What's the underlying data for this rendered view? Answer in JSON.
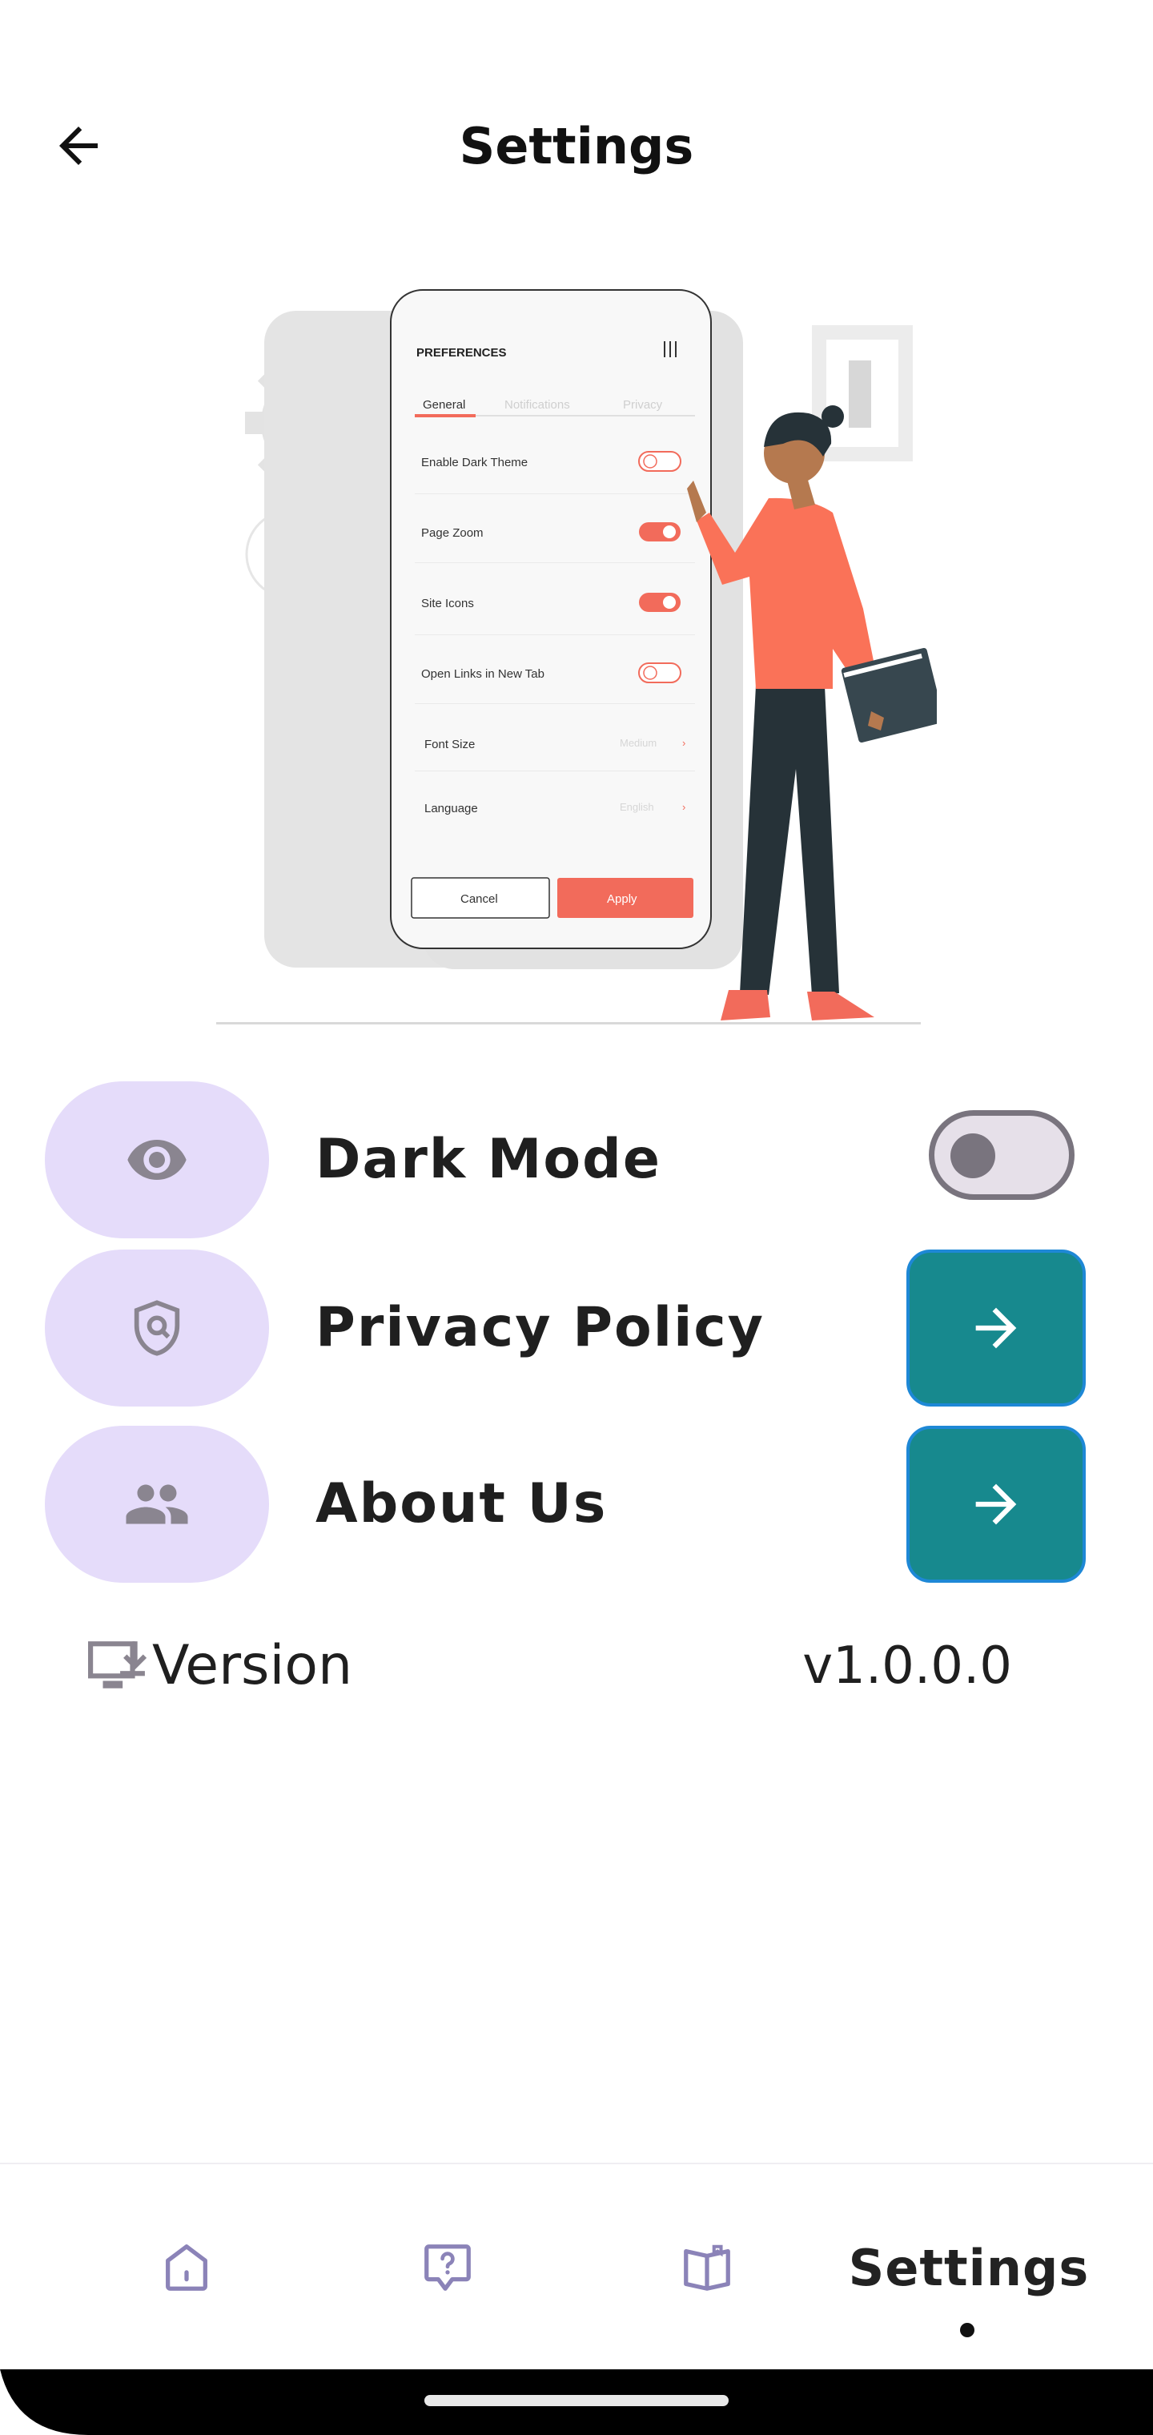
{
  "header": {
    "title": "Settings"
  },
  "illustration": {
    "panel_title": "PREFERENCES",
    "tabs": [
      "General",
      "Notifications",
      "Privacy"
    ],
    "options": [
      {
        "label": "Enable Dark Theme",
        "state": "off"
      },
      {
        "label": "Page Zoom",
        "state": "on"
      },
      {
        "label": "Site Icons",
        "state": "on"
      },
      {
        "label": "Open Links in New Tab",
        "state": "off"
      }
    ],
    "font_size_label": "Font Size",
    "font_size_value": "Medium",
    "language_label": "Language",
    "language_value": "English",
    "cancel_label": "Cancel",
    "apply_label": "Apply",
    "accent_color": "#f26b5b"
  },
  "settings": {
    "dark_mode": {
      "label": "Dark Mode",
      "icon": "eye-icon",
      "enabled": false
    },
    "privacy_policy": {
      "label": "Privacy Policy",
      "icon": "shield-icon",
      "action": "arrow-right-icon"
    },
    "about_us": {
      "label": "About Us",
      "icon": "people-icon",
      "action": "arrow-right-icon"
    }
  },
  "version": {
    "label": "Version",
    "value": "v1.0.0.0",
    "icon": "download-monitor-icon"
  },
  "bottom_nav": {
    "items": [
      {
        "icon": "home-icon"
      },
      {
        "icon": "question-bubble-icon"
      },
      {
        "icon": "book-icon"
      },
      {
        "label": "Settings",
        "active": true
      }
    ]
  },
  "colors": {
    "tile_background": "#e5dcfa",
    "arrow_button": "#17898e",
    "icon_gray": "#8a8590",
    "nav_icon": "#8b83b8"
  }
}
